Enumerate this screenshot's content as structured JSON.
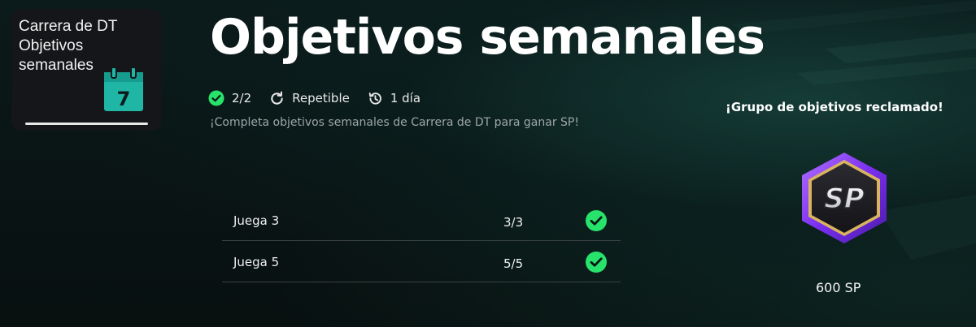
{
  "category_card": {
    "title_line1": "Carrera de DT",
    "title_line2": "Objetivos",
    "title_line3": "semanales",
    "icon": "calendar-icon",
    "calendar_day": "7"
  },
  "header": {
    "title": "Objetivos semanales",
    "completed": "2/2",
    "repeat_label": "Repetible",
    "time_left": "1 día",
    "description": "¡Completa objetivos semanales de Carrera de DT para ganar SP!"
  },
  "objectives": [
    {
      "name": "Juega 3",
      "progress": "3/3",
      "status_icon": "check-circle-icon"
    },
    {
      "name": "Juega 5",
      "progress": "5/5",
      "status_icon": "check-circle-icon"
    }
  ],
  "reward": {
    "heading": "¡Grupo de objetivos reclamado!",
    "badge_text": "SP",
    "amount": "600 SP"
  },
  "colors": {
    "accent_green": "#27e36b",
    "calendar_teal": "#1fb6a6",
    "badge_purple": "#8a3fff",
    "badge_gold": "#d9b35f"
  }
}
